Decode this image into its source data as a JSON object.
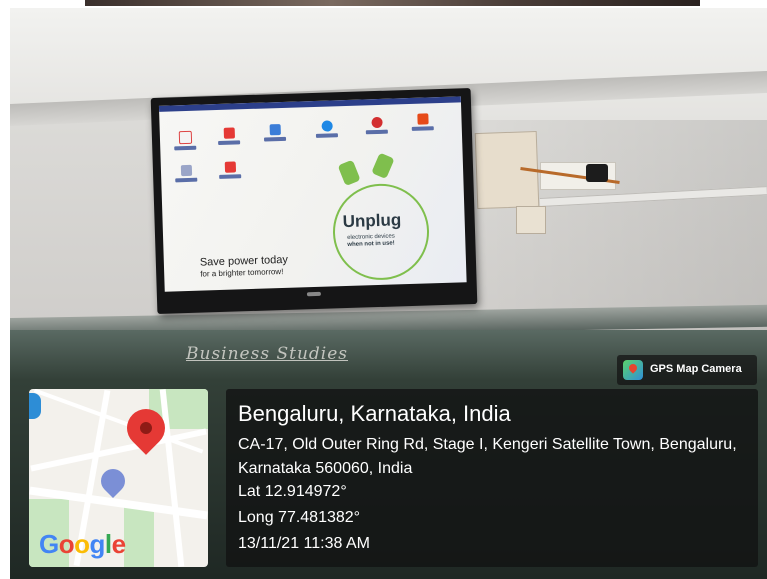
{
  "photo_scene": {
    "tv_screen": {
      "headline_1": "Save power today",
      "headline_2": "for a brighter tomorrow!",
      "poster_title": "Unplug",
      "poster_sub_1": "electronic devices",
      "poster_sub_2": "when not in use!"
    },
    "chalkboard_text": "Business Studies"
  },
  "gps_overlay": {
    "badge_label": "GPS Map Camera",
    "map_brand": "Google",
    "location_title": "Bengaluru, Karnataka, India",
    "address": "CA-17, Old Outer Ring Rd, Stage I, Kengeri Satellite Town, Bengaluru, Karnataka 560060, India",
    "latitude": "Lat 12.914972°",
    "longitude": "Long 77.481382°",
    "datetime": "13/11/21 11:38 AM",
    "icon": "gps-map-camera-icon",
    "colors": {
      "pin_red": "#e53935",
      "google_blue": "#4285f4",
      "google_red": "#ea4335",
      "google_yellow": "#fbbc05",
      "google_green": "#34a853"
    }
  }
}
